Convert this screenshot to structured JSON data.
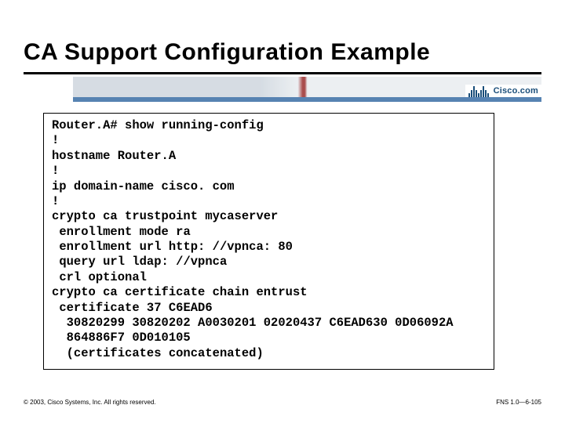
{
  "title": "CA Support Configuration Example",
  "logo_text": "Cisco.com",
  "code_lines": [
    "Router.A# show running-config",
    "!",
    "hostname Router.A",
    "!",
    "ip domain-name cisco. com",
    "!",
    "crypto ca trustpoint mycaserver",
    " enrollment mode ra",
    " enrollment url http: //vpnca: 80",
    " query url ldap: //vpnca",
    " crl optional",
    "crypto ca certificate chain entrust",
    " certificate 37 C6EAD6",
    "  30820299 30820202 A0030201 02020437 C6EAD630 0D06092A",
    "  864886F7 0D010105",
    "  (certificates concatenated)"
  ],
  "footer": {
    "left": "© 2003, Cisco Systems, Inc. All rights reserved.",
    "right": "FNS 1.0—6-105"
  }
}
